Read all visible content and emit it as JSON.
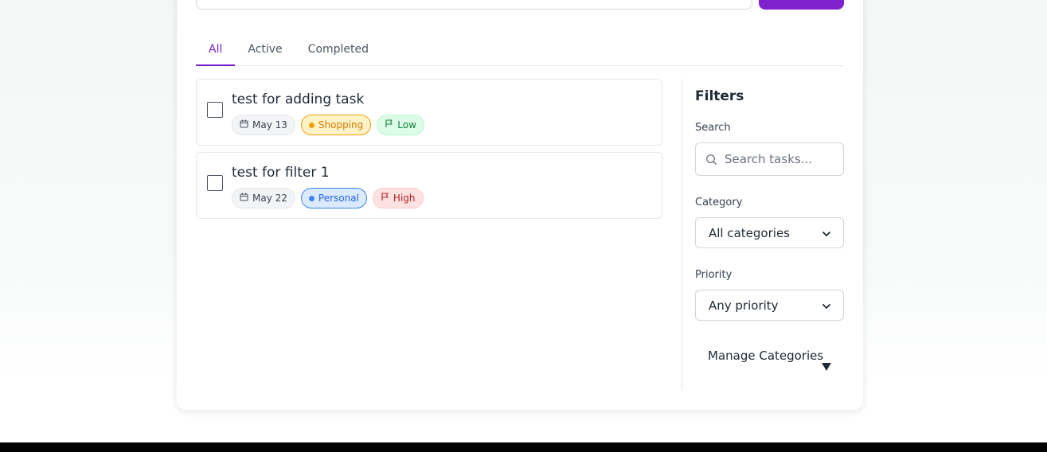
{
  "tabs": [
    {
      "label": "All",
      "active": true
    },
    {
      "label": "Active",
      "active": false
    },
    {
      "label": "Completed",
      "active": false
    }
  ],
  "tasks": [
    {
      "title": "test for adding task",
      "date": "May 13",
      "category": "Shopping",
      "priority": "Low",
      "completed": false
    },
    {
      "title": "test for filter 1",
      "date": "May 22",
      "category": "Personal",
      "priority": "High",
      "completed": false
    }
  ],
  "filters": {
    "title": "Filters",
    "search_label": "Search",
    "search_placeholder": "Search tasks...",
    "category_label": "Category",
    "category_value": "All categories",
    "priority_label": "Priority",
    "priority_value": "Any priority",
    "manage_categories": "Manage Categories"
  },
  "colors": {
    "accent": "#7e22ce",
    "shopping": "#f59e0b",
    "personal": "#3b82f6",
    "low": "#15803d",
    "high": "#b91c1c"
  },
  "icons": {
    "date": "calendar-icon",
    "category": "dot-icon",
    "priority": "flag-icon",
    "search": "search-icon",
    "select": "chevron-down-icon",
    "manage": "triangle-down-icon"
  }
}
